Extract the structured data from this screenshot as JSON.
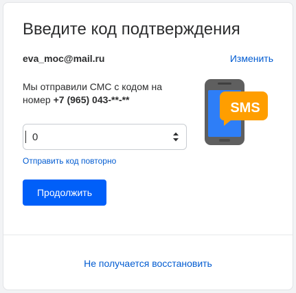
{
  "title": "Введите код подтверждения",
  "account": {
    "email": "eva_moc@mail.ru",
    "change_label": "Изменить"
  },
  "message": {
    "text_before": "Мы отправили СМС с кодом на номер ",
    "phone": "+7 (965) 043-**-**"
  },
  "illustration": {
    "icon": "phone-sms-icon",
    "badge_text": "SMS",
    "badge_color": "#ff9e00",
    "phone_color": "#5f5f5f",
    "screen_color": "#2e7ef7"
  },
  "code_field": {
    "value": "0"
  },
  "resend_label": "Отправить код повторно",
  "continue_label": "Продолжить",
  "recover_label": "Не получается восстановить",
  "colors": {
    "link": "#005bd1",
    "primary_button": "#005ff9"
  }
}
